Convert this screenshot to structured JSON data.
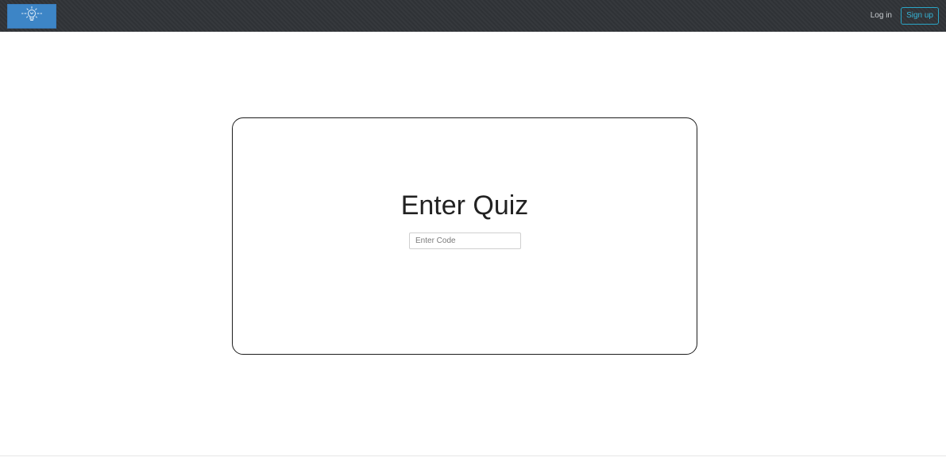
{
  "navbar": {
    "logo_icon": "lightbulb-icon",
    "login_label": "Log in",
    "signup_label": "Sign up",
    "colors": {
      "background": "#2f3236",
      "logo_bg": "#3d85c6",
      "signup_accent": "#2aa6c7"
    }
  },
  "quiz": {
    "title": "Enter Quiz",
    "code_placeholder": "Enter Code",
    "code_value": ""
  },
  "footer": {
    "left_text": "",
    "right_text": ""
  }
}
